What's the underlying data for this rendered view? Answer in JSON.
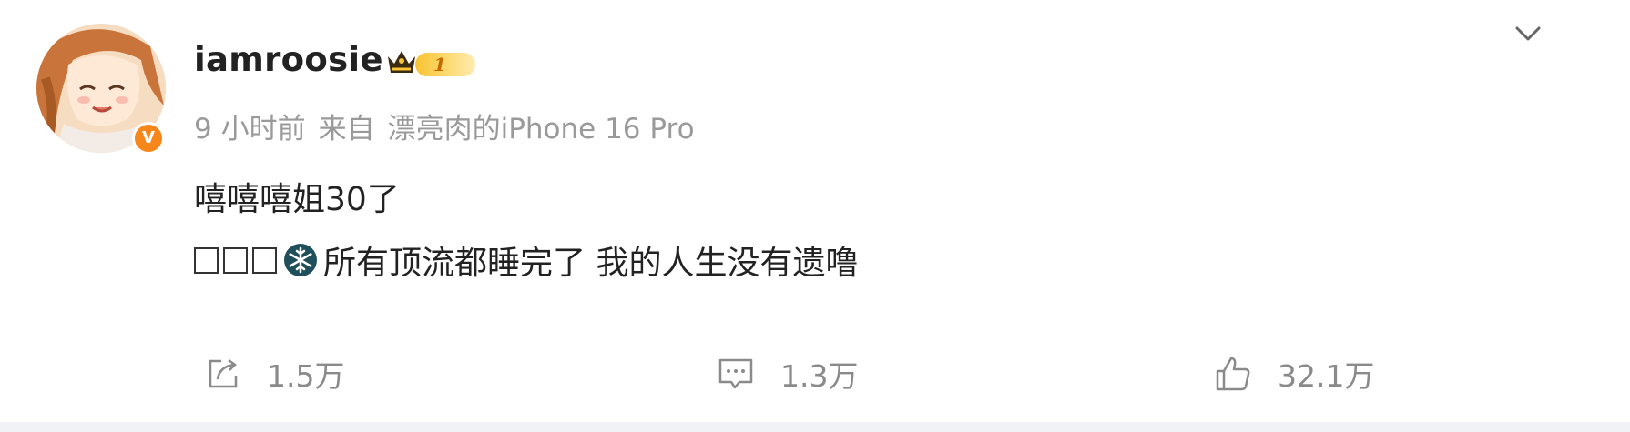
{
  "post": {
    "username": "iamroosie",
    "level": "1",
    "verified_badge": "V",
    "time": "9 小时前",
    "source_prefix": "来自",
    "source_device": "漂亮肉的iPhone 16 Pro",
    "text_line1": "嘻嘻嘻姐30了",
    "text_line2": "所有顶流都睡完了 我的人生没有遗噜"
  },
  "actions": {
    "share_count": "1.5万",
    "comment_count": "1.3万",
    "like_count": "32.1万"
  },
  "icons": {
    "crown": "crown-icon",
    "snowflake": "snowflake-icon",
    "menu": "chevron-down-icon",
    "share": "share-icon",
    "comment": "comment-icon",
    "like": "thumbs-up-icon"
  },
  "colors": {
    "verified_orange": "#f7861b",
    "level_gold": "#f9c232",
    "meta_gray": "#9a9a9a",
    "snowflake_teal": "#1f6f7a"
  }
}
